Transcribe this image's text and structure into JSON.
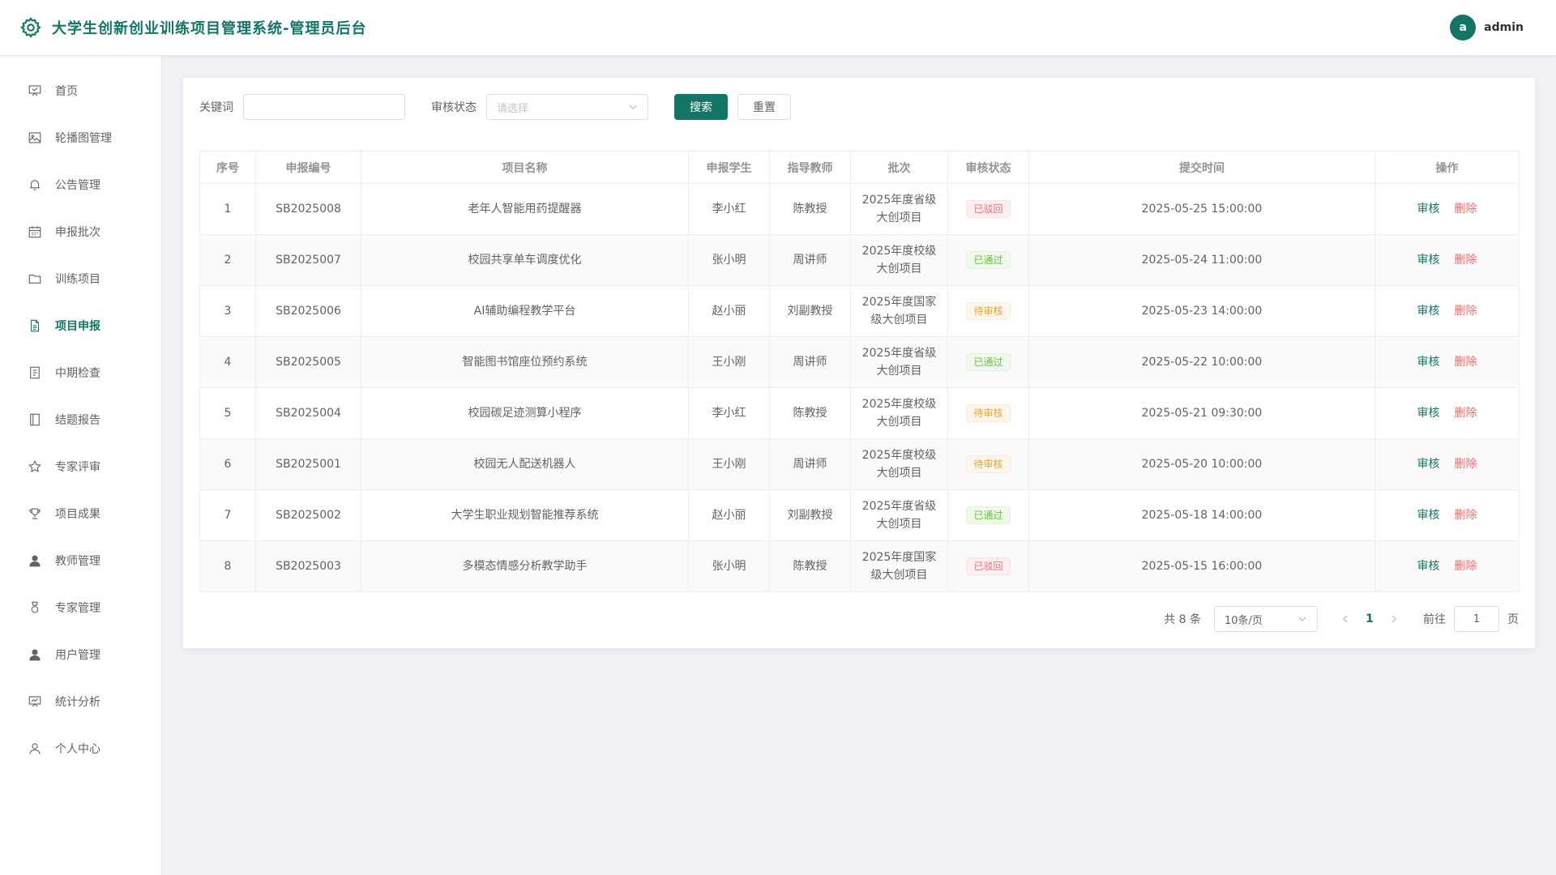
{
  "header": {
    "title": "大学生创新创业训练项目管理系统-管理员后台",
    "avatar_letter": "a",
    "username": "admin"
  },
  "sidebar": {
    "items": [
      {
        "label": "首页",
        "icon": "presentation-icon",
        "active": false
      },
      {
        "label": "轮播图管理",
        "icon": "picture-icon",
        "active": false
      },
      {
        "label": "公告管理",
        "icon": "bell-icon",
        "active": false
      },
      {
        "label": "申报批次",
        "icon": "calendar-icon",
        "active": false
      },
      {
        "label": "训练项目",
        "icon": "folder-icon",
        "active": false
      },
      {
        "label": "项目申报",
        "icon": "document-icon",
        "active": true
      },
      {
        "label": "中期检查",
        "icon": "tickets-icon",
        "active": false
      },
      {
        "label": "结题报告",
        "icon": "notebook-icon",
        "active": false
      },
      {
        "label": "专家评审",
        "icon": "star-icon",
        "active": false
      },
      {
        "label": "项目成果",
        "icon": "trophy-icon",
        "active": false
      },
      {
        "label": "教师管理",
        "icon": "user-filled-icon",
        "active": false
      },
      {
        "label": "专家管理",
        "icon": "medal-icon",
        "active": false
      },
      {
        "label": "用户管理",
        "icon": "avatar-icon",
        "active": false
      },
      {
        "label": "统计分析",
        "icon": "data-board-icon",
        "active": false
      },
      {
        "label": "个人中心",
        "icon": "user-icon",
        "active": false
      }
    ]
  },
  "search": {
    "keyword_label": "关键词",
    "keyword_value": "",
    "status_label": "审核状态",
    "status_placeholder": "请选择",
    "search_button": "搜索",
    "reset_button": "重置"
  },
  "table": {
    "columns": [
      "序号",
      "申报编号",
      "项目名称",
      "申报学生",
      "指导教师",
      "批次",
      "审核状态",
      "提交时间",
      "操作"
    ],
    "rows": [
      {
        "index": "1",
        "code": "SB2025008",
        "name": "老年人智能用药提醒器",
        "student": "李小红",
        "teacher": "陈教授",
        "batch": "2025年度省级大创项目",
        "status": "已驳回",
        "status_type": "rejected",
        "time": "2025-05-25 15:00:00"
      },
      {
        "index": "2",
        "code": "SB2025007",
        "name": "校园共享单车调度优化",
        "student": "张小明",
        "teacher": "周讲师",
        "batch": "2025年度校级大创项目",
        "status": "已通过",
        "status_type": "passed",
        "time": "2025-05-24 11:00:00"
      },
      {
        "index": "3",
        "code": "SB2025006",
        "name": "AI辅助编程教学平台",
        "student": "赵小丽",
        "teacher": "刘副教授",
        "batch": "2025年度国家级大创项目",
        "status": "待审核",
        "status_type": "pending",
        "time": "2025-05-23 14:00:00"
      },
      {
        "index": "4",
        "code": "SB2025005",
        "name": "智能图书馆座位预约系统",
        "student": "王小刚",
        "teacher": "周讲师",
        "batch": "2025年度省级大创项目",
        "status": "已通过",
        "status_type": "passed",
        "time": "2025-05-22 10:00:00"
      },
      {
        "index": "5",
        "code": "SB2025004",
        "name": "校园碳足迹测算小程序",
        "student": "李小红",
        "teacher": "陈教授",
        "batch": "2025年度校级大创项目",
        "status": "待审核",
        "status_type": "pending",
        "time": "2025-05-21 09:30:00"
      },
      {
        "index": "6",
        "code": "SB2025001",
        "name": "校园无人配送机器人",
        "student": "王小刚",
        "teacher": "周讲师",
        "batch": "2025年度校级大创项目",
        "status": "待审核",
        "status_type": "pending",
        "time": "2025-05-20 10:00:00"
      },
      {
        "index": "7",
        "code": "SB2025002",
        "name": "大学生职业规划智能推荐系统",
        "student": "赵小丽",
        "teacher": "刘副教授",
        "batch": "2025年度省级大创项目",
        "status": "已通过",
        "status_type": "passed",
        "time": "2025-05-18 14:00:00"
      },
      {
        "index": "8",
        "code": "SB2025003",
        "name": "多模态情感分析教学助手",
        "student": "张小明",
        "teacher": "陈教授",
        "batch": "2025年度国家级大创项目",
        "status": "已驳回",
        "status_type": "rejected",
        "time": "2025-05-15 16:00:00"
      }
    ],
    "action_review": "审核",
    "action_delete": "删除"
  },
  "pagination": {
    "total_text": "共 8 条",
    "page_size": "10条/页",
    "current_page": "1",
    "goto_label": "前往",
    "goto_value": "1",
    "page_suffix": "页"
  },
  "colors": {
    "primary": "#137565",
    "danger": "#f56c6c",
    "success": "#67c23a",
    "warning": "#e6a23c"
  }
}
